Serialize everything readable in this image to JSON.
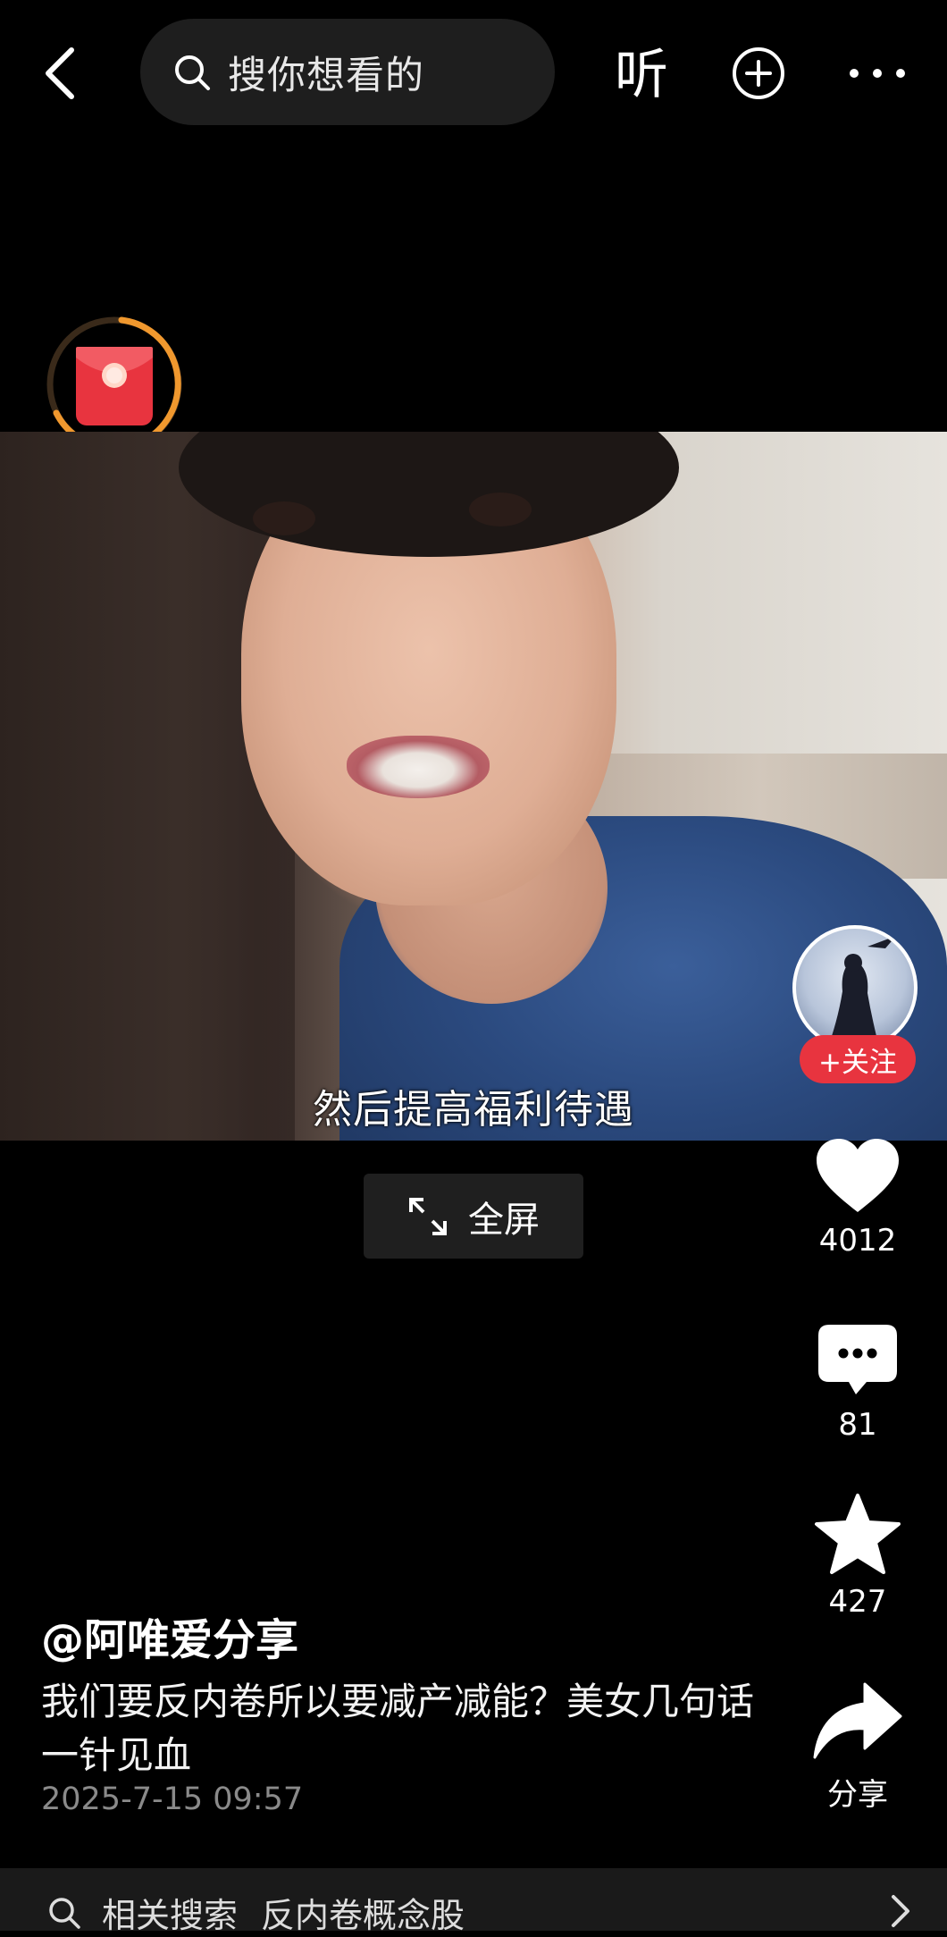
{
  "header": {
    "search_placeholder": "搜你想看的",
    "listen_label": "听"
  },
  "video": {
    "subtitle": "然后提高福利待遇",
    "fullscreen_label": "全屏"
  },
  "author": {
    "name": "@阿唯爱分享",
    "follow_label": "+关注"
  },
  "actions": {
    "likes": "4012",
    "comments": "81",
    "favorites": "427",
    "share_label": "分享"
  },
  "post": {
    "description": "我们要反内卷所以要减产减能？美女几句话一针见血",
    "date": "2025-7-15 09:57"
  },
  "related": {
    "prefix": "相关搜索",
    "query": "反内卷概念股"
  },
  "colors": {
    "background": "#000000",
    "follow_red": "#e8343f",
    "red_packet_ring": "#f0982e"
  },
  "icons": [
    "back-arrow-icon",
    "search-icon",
    "add-circle-icon",
    "more-dots-icon",
    "red-packet-icon",
    "expand-icon",
    "heart-icon",
    "comment-icon",
    "star-icon",
    "share-arrow-icon",
    "chevron-right-icon"
  ]
}
